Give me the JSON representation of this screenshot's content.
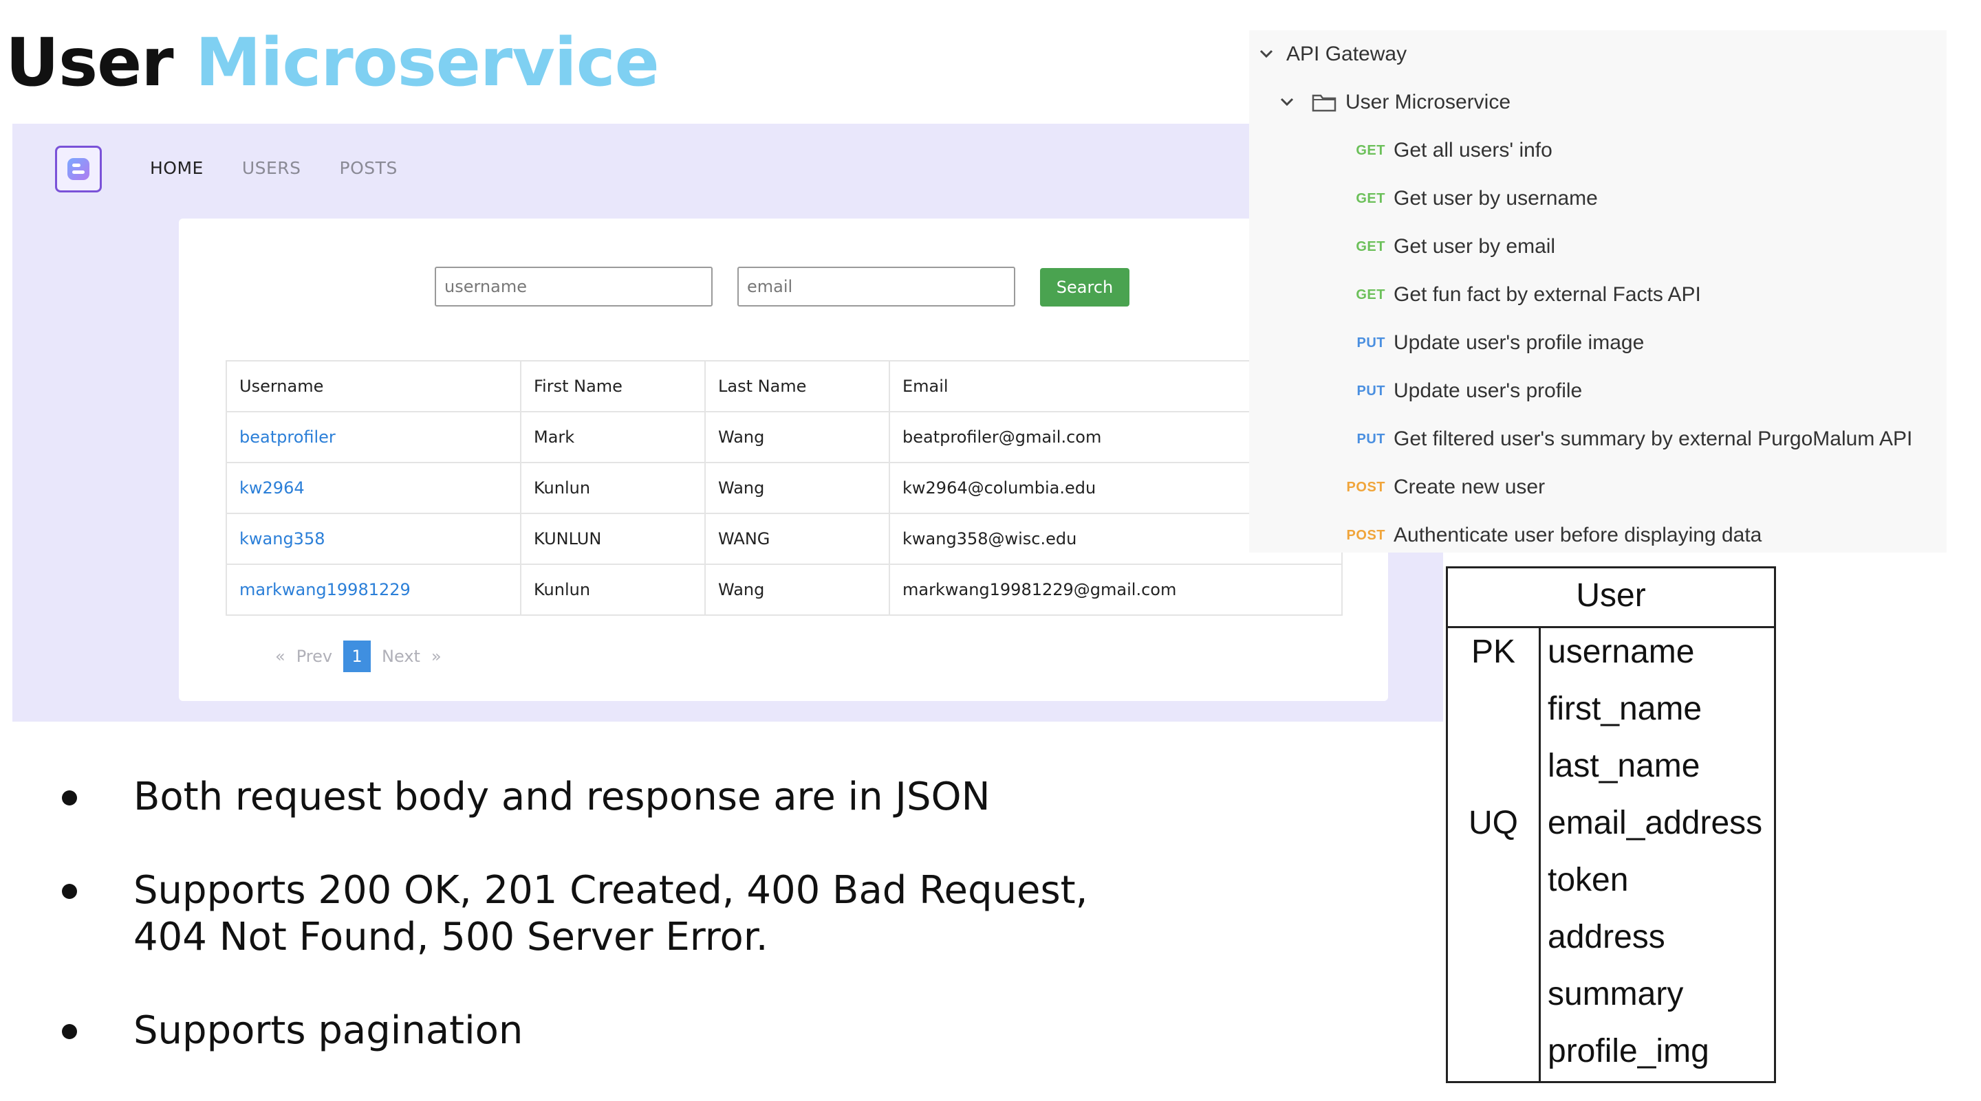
{
  "slide": {
    "title_part1": "User",
    "title_part2": "Microservice"
  },
  "webapp": {
    "nav": {
      "home": "HOME",
      "users": "USERS",
      "posts": "POSTS"
    },
    "search": {
      "username_placeholder": "username",
      "email_placeholder": "email",
      "button_label": "Search"
    },
    "table": {
      "headers": [
        "Username",
        "First Name",
        "Last Name",
        "Email"
      ],
      "rows": [
        {
          "username": "beatprofiler",
          "first_name": "Mark",
          "last_name": "Wang",
          "email": "beatprofiler@gmail.com"
        },
        {
          "username": "kw2964",
          "first_name": "Kunlun",
          "last_name": "Wang",
          "email": "kw2964@columbia.edu"
        },
        {
          "username": "kwang358",
          "first_name": "KUNLUN",
          "last_name": "WANG",
          "email": "kwang358@wisc.edu"
        },
        {
          "username": "markwang19981229",
          "first_name": "Kunlun",
          "last_name": "Wang",
          "email": "markwang19981229@gmail.com"
        }
      ]
    },
    "pagination": {
      "first": "«",
      "prev": "Prev",
      "current": "1",
      "next": "Next",
      "last": "»"
    },
    "colors": {
      "background": "#e9e7fb",
      "search_button": "#4aa350",
      "link": "#2b7fd8",
      "active_page": "#3f8fe0"
    }
  },
  "api_tree": {
    "root": "API Gateway",
    "folder": "User Microservice",
    "endpoints": [
      {
        "method": "GET",
        "name": "Get all users' info"
      },
      {
        "method": "GET",
        "name": "Get user by username"
      },
      {
        "method": "GET",
        "name": "Get user by email"
      },
      {
        "method": "GET",
        "name": "Get fun fact by external Facts API"
      },
      {
        "method": "PUT",
        "name": "Update user's profile image"
      },
      {
        "method": "PUT",
        "name": "Update user's profile"
      },
      {
        "method": "PUT",
        "name": "Get filtered user's summary by external PurgoMalum API"
      },
      {
        "method": "POST",
        "name": "Create new user"
      },
      {
        "method": "POST",
        "name": "Authenticate user before displaying data"
      }
    ]
  },
  "entity": {
    "name": "User",
    "rows": [
      {
        "key": "PK",
        "field": "username"
      },
      {
        "key": "",
        "field": "first_name"
      },
      {
        "key": "",
        "field": "last_name"
      },
      {
        "key": "UQ",
        "field": "email_address"
      },
      {
        "key": "",
        "field": "token"
      },
      {
        "key": "",
        "field": "address"
      },
      {
        "key": "",
        "field": "summary"
      },
      {
        "key": "",
        "field": "profile_img"
      }
    ]
  },
  "bullets": [
    {
      "line1": "Both request body and response are in JSON",
      "line2": ""
    },
    {
      "line1": "Supports 200 OK, 201 Created, 400 Bad Request,",
      "line2": "404 Not Found, 500 Server Error."
    },
    {
      "line1": "Supports pagination",
      "line2": ""
    }
  ]
}
